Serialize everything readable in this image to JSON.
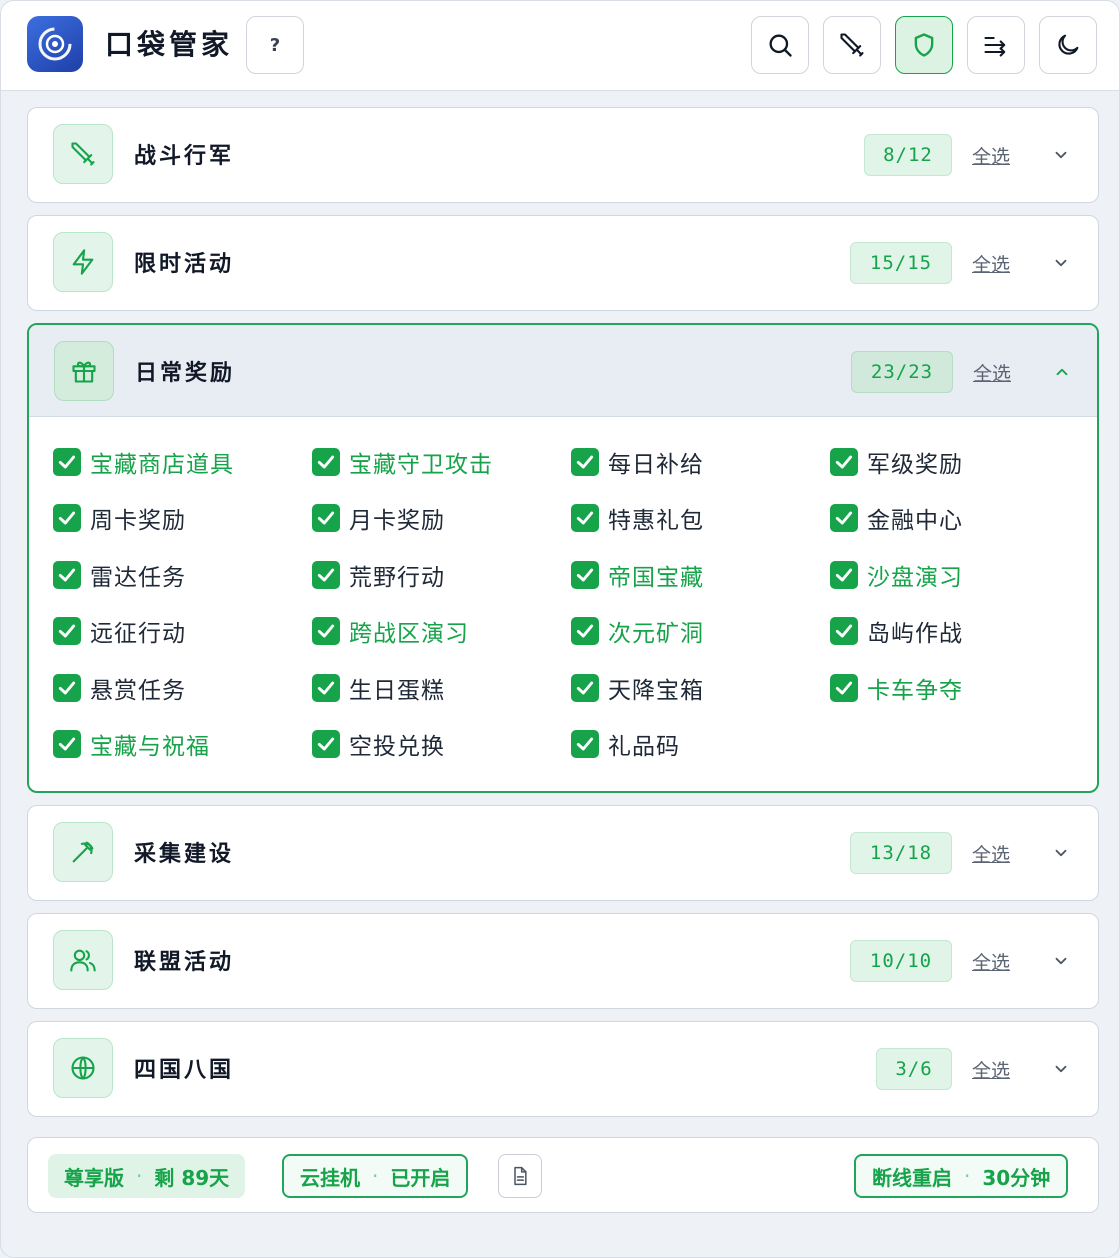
{
  "app": {
    "title": "口袋管家",
    "help_label": "?"
  },
  "header_buttons": [
    {
      "icon": "search-icon"
    },
    {
      "icon": "sword-icon"
    },
    {
      "icon": "shield-icon",
      "active": true
    },
    {
      "icon": "sort-icon"
    },
    {
      "icon": "moon-icon"
    }
  ],
  "sections": [
    {
      "title": "战斗行军",
      "count": "8/12",
      "select_all": "全选",
      "icon": "sword-icon",
      "expanded": false
    },
    {
      "title": "限时活动",
      "count": "15/15",
      "select_all": "全选",
      "icon": "lightning-icon",
      "expanded": false
    },
    {
      "title": "日常奖励",
      "count": "23/23",
      "select_all": "全选",
      "icon": "gift-icon",
      "expanded": true
    },
    {
      "title": "采集建设",
      "count": "13/18",
      "select_all": "全选",
      "icon": "pickaxe-icon",
      "expanded": false
    },
    {
      "title": "联盟活动",
      "count": "10/10",
      "select_all": "全选",
      "icon": "users-icon",
      "expanded": false
    },
    {
      "title": "四国八国",
      "count": "3/6",
      "select_all": "全选",
      "icon": "globe-icon",
      "expanded": false
    }
  ],
  "daily_items": [
    {
      "label": "宝藏商店道具",
      "checked": true,
      "highlight": true
    },
    {
      "label": "宝藏守卫攻击",
      "checked": true,
      "highlight": true
    },
    {
      "label": "每日补给",
      "checked": true,
      "highlight": false
    },
    {
      "label": "军级奖励",
      "checked": true,
      "highlight": false
    },
    {
      "label": "周卡奖励",
      "checked": true,
      "highlight": false
    },
    {
      "label": "月卡奖励",
      "checked": true,
      "highlight": false
    },
    {
      "label": "特惠礼包",
      "checked": true,
      "highlight": false
    },
    {
      "label": "金融中心",
      "checked": true,
      "highlight": false
    },
    {
      "label": "雷达任务",
      "checked": true,
      "highlight": false
    },
    {
      "label": "荒野行动",
      "checked": true,
      "highlight": false
    },
    {
      "label": "帝国宝藏",
      "checked": true,
      "highlight": true
    },
    {
      "label": "沙盘演习",
      "checked": true,
      "highlight": true
    },
    {
      "label": "远征行动",
      "checked": true,
      "highlight": false
    },
    {
      "label": "跨战区演习",
      "checked": true,
      "highlight": true
    },
    {
      "label": "次元矿洞",
      "checked": true,
      "highlight": true
    },
    {
      "label": "岛屿作战",
      "checked": true,
      "highlight": false
    },
    {
      "label": "悬赏任务",
      "checked": true,
      "highlight": false
    },
    {
      "label": "生日蛋糕",
      "checked": true,
      "highlight": false
    },
    {
      "label": "天降宝箱",
      "checked": true,
      "highlight": false
    },
    {
      "label": "卡车争夺",
      "checked": true,
      "highlight": true
    },
    {
      "label": "宝藏与祝福",
      "checked": true,
      "highlight": true
    },
    {
      "label": "空投兑换",
      "checked": true,
      "highlight": false
    },
    {
      "label": "礼品码",
      "checked": true,
      "highlight": false
    }
  ],
  "footer": {
    "vip_label": "尊享版",
    "vip_remaining": "剩 89天",
    "cloud_label": "云挂机",
    "cloud_status": "已开启",
    "reconnect_label": "断线重启",
    "reconnect_interval": "30分钟",
    "separator": "·"
  },
  "colors": {
    "accent": "#16a34a",
    "accent_bg": "#e1f4e8",
    "logo": "#2f58c9"
  }
}
